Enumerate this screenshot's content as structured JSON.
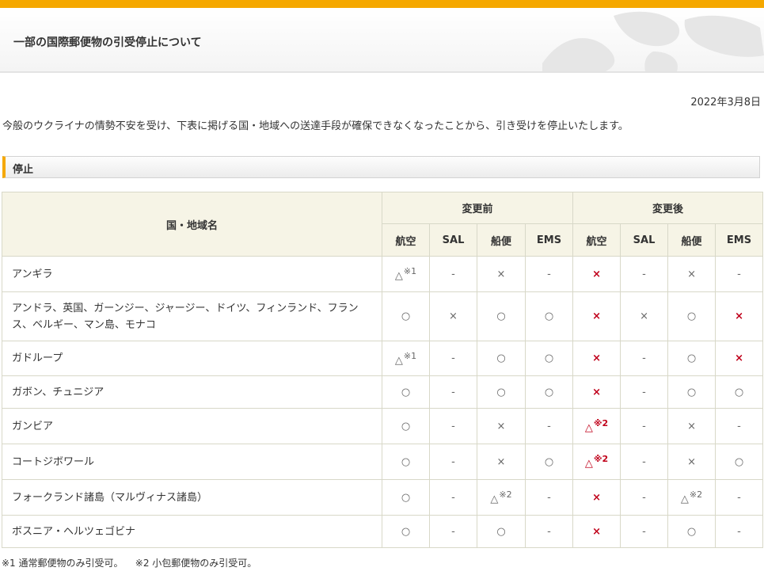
{
  "header": {
    "title": "一部の国際郵便物の引受停止について"
  },
  "date": "2022年3月8日",
  "intro": "今般のウクライナの情勢不安を受け、下表に掲げる国・地域への送達手段が確保できなくなったことから、引き受けを停止いたします。",
  "section": {
    "heading": "停止"
  },
  "table": {
    "country_header": "国・地域名",
    "before_header": "変更前",
    "after_header": "変更後",
    "methods": [
      "航空",
      "SAL",
      "船便",
      "EMS",
      "航空",
      "SAL",
      "船便",
      "EMS"
    ],
    "rows": [
      {
        "name": "アンギラ",
        "cells": [
          {
            "mark": "△",
            "note": "※1"
          },
          {
            "mark": "-"
          },
          {
            "mark": "×"
          },
          {
            "mark": "-"
          },
          {
            "mark": "×",
            "red": true
          },
          {
            "mark": "-"
          },
          {
            "mark": "×"
          },
          {
            "mark": "-"
          }
        ]
      },
      {
        "name": "アンドラ、英国、ガーンジー、ジャージー、ドイツ、フィンランド、フランス、ベルギー、マン島、モナコ",
        "cells": [
          {
            "mark": "○"
          },
          {
            "mark": "×"
          },
          {
            "mark": "○"
          },
          {
            "mark": "○"
          },
          {
            "mark": "×",
            "red": true
          },
          {
            "mark": "×"
          },
          {
            "mark": "○"
          },
          {
            "mark": "×",
            "red": true
          }
        ]
      },
      {
        "name": "ガドループ",
        "cells": [
          {
            "mark": "△",
            "note": "※1"
          },
          {
            "mark": "-"
          },
          {
            "mark": "○"
          },
          {
            "mark": "○"
          },
          {
            "mark": "×",
            "red": true
          },
          {
            "mark": "-"
          },
          {
            "mark": "○"
          },
          {
            "mark": "×",
            "red": true
          }
        ]
      },
      {
        "name": "ガボン、チュニジア",
        "cells": [
          {
            "mark": "○"
          },
          {
            "mark": "-"
          },
          {
            "mark": "○"
          },
          {
            "mark": "○"
          },
          {
            "mark": "×",
            "red": true
          },
          {
            "mark": "-"
          },
          {
            "mark": "○"
          },
          {
            "mark": "○"
          }
        ]
      },
      {
        "name": "ガンビア",
        "cells": [
          {
            "mark": "○"
          },
          {
            "mark": "-"
          },
          {
            "mark": "×"
          },
          {
            "mark": "-"
          },
          {
            "mark": "△",
            "note": "※2",
            "red": true
          },
          {
            "mark": "-"
          },
          {
            "mark": "×"
          },
          {
            "mark": "-"
          }
        ]
      },
      {
        "name": "コートジボワール",
        "cells": [
          {
            "mark": "○"
          },
          {
            "mark": "-"
          },
          {
            "mark": "×"
          },
          {
            "mark": "○"
          },
          {
            "mark": "△",
            "note": "※2",
            "red": true
          },
          {
            "mark": "-"
          },
          {
            "mark": "×"
          },
          {
            "mark": "○"
          }
        ]
      },
      {
        "name": "フォークランド諸島（マルヴィナス諸島）",
        "cells": [
          {
            "mark": "○"
          },
          {
            "mark": "-"
          },
          {
            "mark": "△",
            "note": "※2"
          },
          {
            "mark": "-"
          },
          {
            "mark": "×",
            "red": true
          },
          {
            "mark": "-"
          },
          {
            "mark": "△",
            "note": "※2"
          },
          {
            "mark": "-"
          }
        ]
      },
      {
        "name": "ボスニア・ヘルツェゴビナ",
        "cells": [
          {
            "mark": "○"
          },
          {
            "mark": "-"
          },
          {
            "mark": "○"
          },
          {
            "mark": "-"
          },
          {
            "mark": "×",
            "red": true
          },
          {
            "mark": "-"
          },
          {
            "mark": "○"
          },
          {
            "mark": "-"
          }
        ]
      }
    ]
  },
  "footnotes": [
    "※1 通常郵便物のみ引受可。",
    "※2 小包郵便物のみ引受可。"
  ],
  "colors": {
    "accent": "#f5a800",
    "red_mark": "#c0001a",
    "header_bg": "#f6f4e6",
    "border": "#d8d8c8"
  }
}
